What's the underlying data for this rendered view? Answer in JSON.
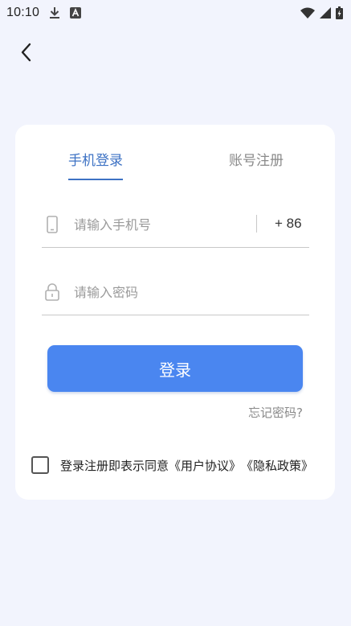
{
  "status_bar": {
    "time": "10:10",
    "icons": [
      "download-icon",
      "app-notification-icon",
      "wifi-icon",
      "signal-icon",
      "battery-charging-icon"
    ]
  },
  "nav": {
    "back_icon": "chevron-left-icon"
  },
  "tabs": [
    {
      "label": "手机登录",
      "active": true
    },
    {
      "label": "账号注册",
      "active": false
    }
  ],
  "form": {
    "phone": {
      "icon": "mobile-phone-icon",
      "placeholder": "请输入手机号",
      "value": "",
      "country_code": "+ 86"
    },
    "password": {
      "icon": "lock-icon",
      "placeholder": "请输入密码",
      "value": ""
    },
    "login_label": "登录",
    "forgot_label": "忘记密码?"
  },
  "agreement": {
    "checked": false,
    "text": "登录注册即表示同意",
    "user_agreement": "《用户协议》",
    "privacy_policy": "《隐私政策》"
  },
  "colors": {
    "background": "#f2f4fd",
    "accent": "#3d72c4",
    "button": "#4a86f0"
  }
}
